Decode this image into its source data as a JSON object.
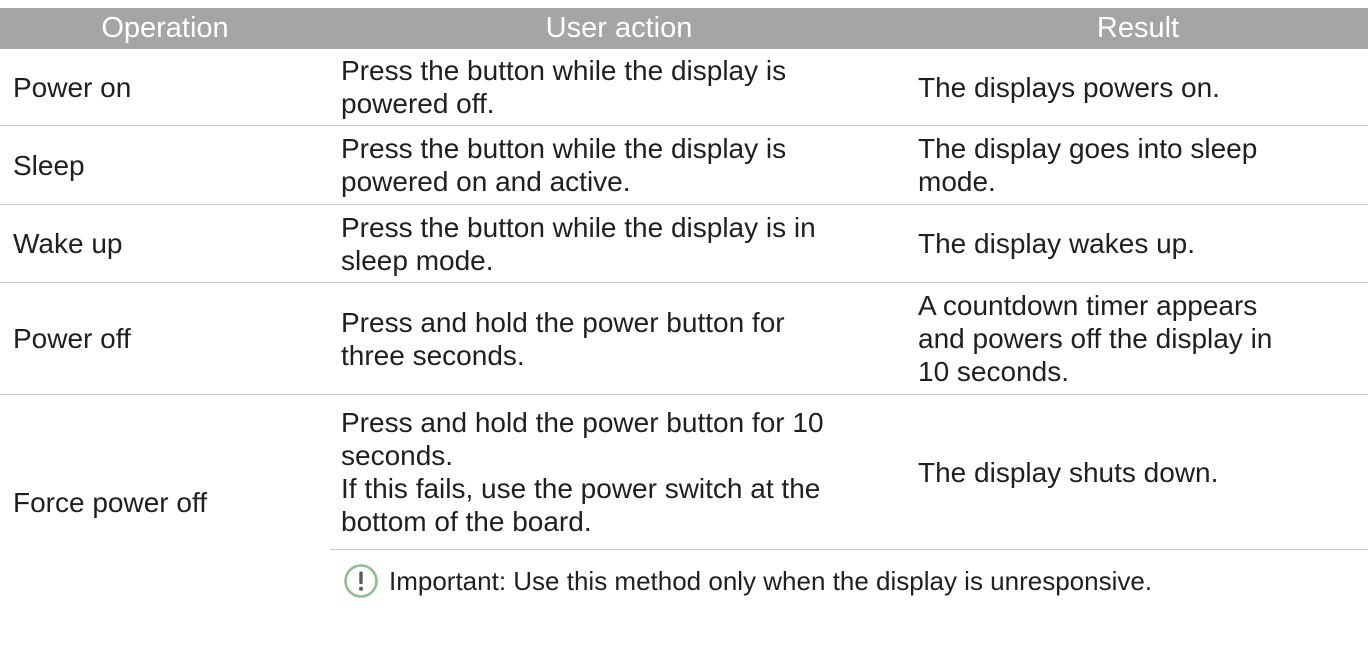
{
  "table": {
    "headers": [
      "Operation",
      "User action",
      "Result"
    ],
    "rows": [
      {
        "operation": "Power on",
        "action": [
          "Press the button while the display is",
          "powered off."
        ],
        "result": [
          "The displays powers on."
        ]
      },
      {
        "operation": "Sleep",
        "action": [
          "Press the button while the display is",
          "powered on and active."
        ],
        "result": [
          "The display goes into sleep",
          "mode."
        ]
      },
      {
        "operation": "Wake up",
        "action": [
          "Press the button while the display is in",
          "sleep mode."
        ],
        "result": [
          "The display wakes up."
        ]
      },
      {
        "operation": "Power off",
        "action": [
          "Press and hold the power button for",
          "three seconds."
        ],
        "result": [
          "A countdown timer appears",
          "and powers off the display in",
          "10 seconds."
        ]
      },
      {
        "operation": "Force power off",
        "action": [
          "Press and hold the power button for 10",
          "seconds.",
          "If this fails, use the power switch at the",
          "bottom of the board."
        ],
        "result": [
          "The display shuts down."
        ]
      }
    ],
    "note": {
      "icon": "exclamation-circle-icon",
      "text": "Important: Use this method only when the display is unresponsive.",
      "icon_color": "#8fbf8f"
    }
  },
  "colors": {
    "header_bg": "#a5a5a5",
    "header_text": "#ffffff",
    "row_divider": "#c9c9c9"
  }
}
